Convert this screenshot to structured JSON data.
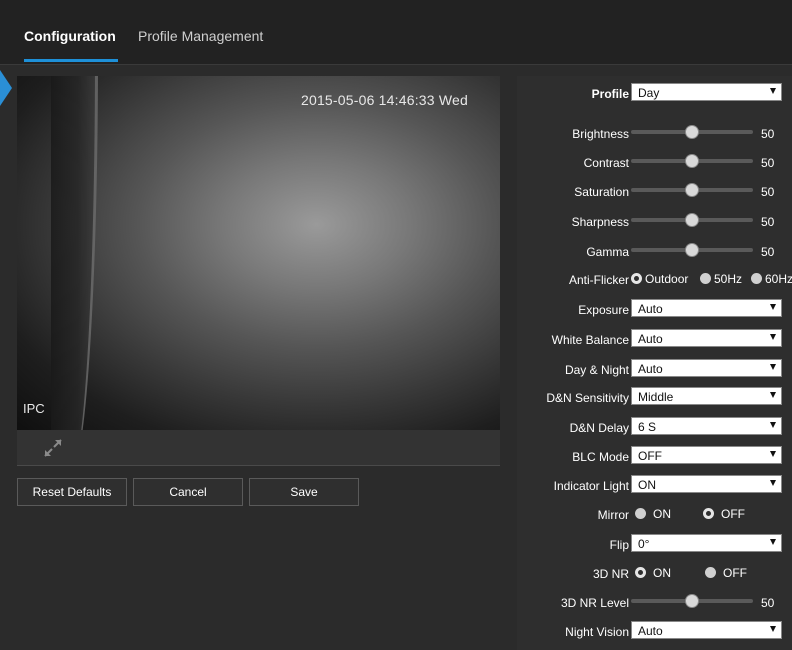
{
  "tabs": {
    "configuration": "Configuration",
    "profile_management": "Profile Management"
  },
  "video": {
    "timestamp": "2015-05-06 14:46:33 Wed",
    "channel_label": "IPC",
    "fullscreen_icon": "fullscreen-expand-icon"
  },
  "buttons": {
    "reset_defaults": "Reset Defaults",
    "cancel": "Cancel",
    "save": "Save"
  },
  "settings": {
    "profile": {
      "label": "Profile",
      "value": "Day"
    },
    "brightness": {
      "label": "Brightness",
      "value": 50
    },
    "contrast": {
      "label": "Contrast",
      "value": 50
    },
    "saturation": {
      "label": "Saturation",
      "value": 50
    },
    "sharpness": {
      "label": "Sharpness",
      "value": 50
    },
    "gamma": {
      "label": "Gamma",
      "value": 50
    },
    "anti_flicker": {
      "label": "Anti-Flicker",
      "options": [
        "Outdoor",
        "50Hz",
        "60Hz"
      ],
      "selected": "Outdoor"
    },
    "exposure": {
      "label": "Exposure",
      "value": "Auto"
    },
    "white_balance": {
      "label": "White Balance",
      "value": "Auto"
    },
    "day_night": {
      "label": "Day & Night",
      "value": "Auto"
    },
    "dn_sensitivity": {
      "label": "D&N Sensitivity",
      "value": "Middle"
    },
    "dn_delay": {
      "label": "D&N Delay",
      "value": "6 S"
    },
    "blc_mode": {
      "label": "BLC Mode",
      "value": "OFF"
    },
    "indicator_light": {
      "label": "Indicator Light",
      "value": "ON"
    },
    "mirror": {
      "label": "Mirror",
      "options": [
        "ON",
        "OFF"
      ],
      "selected": "OFF"
    },
    "flip": {
      "label": "Flip",
      "value": "0°"
    },
    "nr_3d": {
      "label": "3D NR",
      "options": [
        "ON",
        "OFF"
      ],
      "selected": "ON"
    },
    "nr_3d_level": {
      "label": "3D NR Level",
      "value": 50
    },
    "night_vision": {
      "label": "Night Vision",
      "value": "Auto"
    }
  },
  "slider_range": {
    "min": 0,
    "max": 100
  },
  "colors": {
    "accent": "#1e90d8",
    "background": "#2b2b2b",
    "panel": "#2e2e2e"
  }
}
